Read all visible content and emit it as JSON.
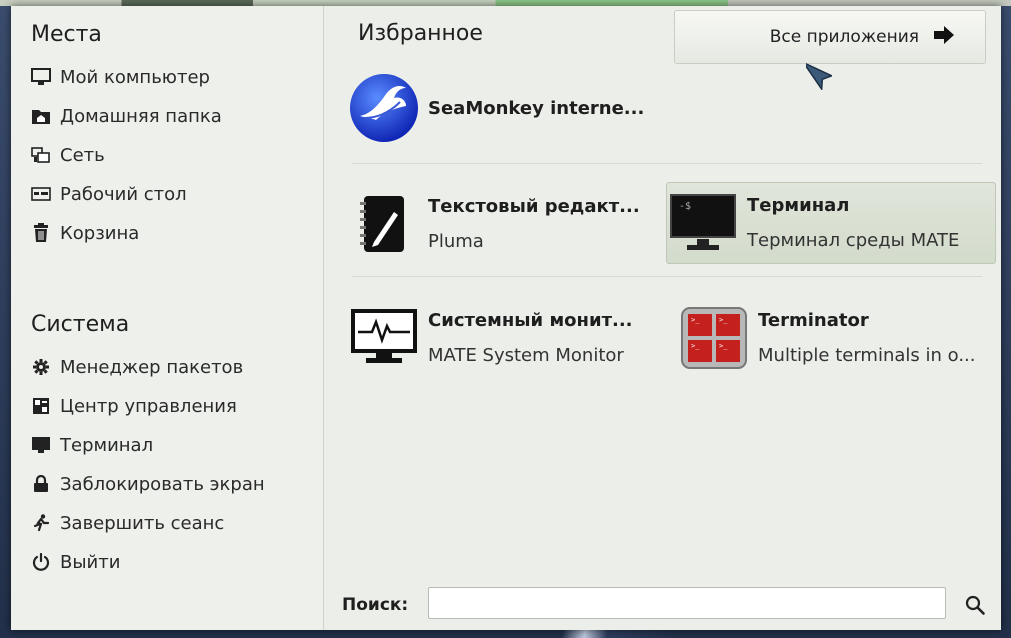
{
  "places": {
    "title": "Места",
    "items": [
      {
        "label": "Мой компьютер",
        "icon": "monitor-icon"
      },
      {
        "label": "Домашняя папка",
        "icon": "home-folder-icon"
      },
      {
        "label": "Сеть",
        "icon": "network-icon"
      },
      {
        "label": "Рабочий стол",
        "icon": "desktop-icon"
      },
      {
        "label": "Корзина",
        "icon": "trash-icon"
      }
    ]
  },
  "system": {
    "title": "Система",
    "items": [
      {
        "label": "Менеджер пакетов",
        "icon": "gear-icon"
      },
      {
        "label": "Центр управления",
        "icon": "control-center-icon"
      },
      {
        "label": "Терминал",
        "icon": "terminal-icon"
      },
      {
        "label": "Заблокировать экран",
        "icon": "lock-icon"
      },
      {
        "label": "Завершить сеанс",
        "icon": "logout-icon"
      },
      {
        "label": "Выйти",
        "icon": "power-icon"
      }
    ]
  },
  "favorites": {
    "title": "Избранное",
    "all_apps_label": "Все приложения",
    "apps": [
      {
        "name": "SeaMonkey interne...",
        "desc": "",
        "icon": "seamonkey-icon"
      },
      {
        "name": "Текстовый редакт...",
        "desc": "Pluma",
        "icon": "text-editor-icon"
      },
      {
        "name": "Терминал",
        "desc": "Терминал среды MATE",
        "icon": "terminal-icon"
      },
      {
        "name": "Системный монит...",
        "desc": "MATE System Monitor",
        "icon": "system-monitor-icon"
      },
      {
        "name": "Terminator",
        "desc": "Multiple terminals in o...",
        "icon": "terminator-icon"
      }
    ]
  },
  "search": {
    "label": "Поиск:",
    "value": "",
    "placeholder": ""
  },
  "colors": {
    "panel": "#eceee9",
    "selected": "#d8dfd1",
    "text": "#222222"
  }
}
